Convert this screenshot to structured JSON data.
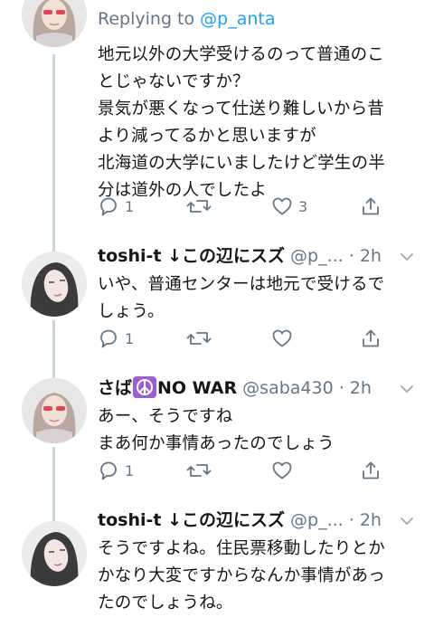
{
  "colors": {
    "text": "#14171a",
    "secondary": "#657786",
    "link": "#1da1f2",
    "thread_line": "#ccd6dd",
    "peace_emoji_bg": "#9b5fd0"
  },
  "tweets": [
    {
      "replying_prefix": "Replying to ",
      "replying_handle": "@p_anta",
      "text": "地元以外の大学受けるのって普通のこ\nとじゃないですか？\n景気が悪くなって仕送り難しいから昔\nより減ってるかと思いますが\n北海道の大学にいましたけど学生の半\n分は道外の人でしたよ",
      "reply_count": "1",
      "like_count": "3"
    },
    {
      "display_name": "toshi-t ↓この辺にスズ",
      "handle_time": "@p_... · 2h",
      "text": "いや、普通センターは地元で受けるで\nしょう。",
      "reply_count": "1"
    },
    {
      "display_name_prefix": "さば",
      "display_name_suffix": "NO WAR",
      "handle_time": "@saba430 · 2h",
      "text": "あー、そうですね\nまあ何か事情あったのでしょう",
      "reply_count": "1"
    },
    {
      "display_name": "toshi-t ↓この辺にスズ",
      "handle_time": "@p_... · 2h",
      "text": "そうですよね。住民票移動したりとか\nかなり大変ですからなんか事情があっ\nたのでしょうね。"
    }
  ]
}
